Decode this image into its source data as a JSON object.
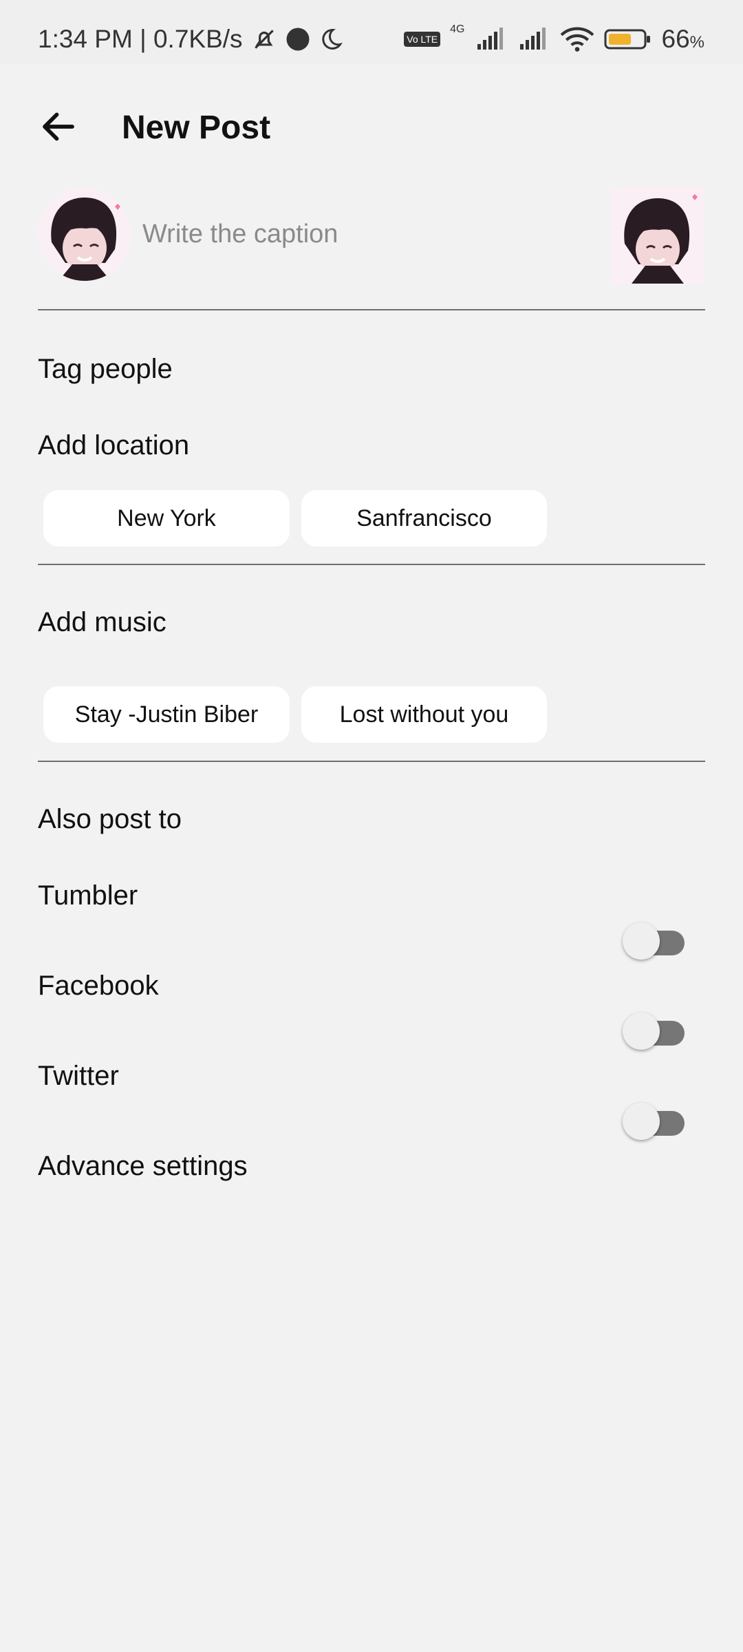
{
  "status_bar": {
    "time_speed": "1:34 PM | 0.7KB/s",
    "network_badge": "Vo LTE",
    "network_type": "4G",
    "battery": "66",
    "battery_unit": "%"
  },
  "header": {
    "title": "New Post"
  },
  "caption": {
    "placeholder": "Write the caption"
  },
  "tag_people": "Tag people",
  "location": {
    "label": "Add location",
    "chips": [
      "New York",
      "Sanfrancisco"
    ]
  },
  "music": {
    "label": "Add music",
    "chips": [
      "Stay -Justin Biber",
      "Lost without you"
    ]
  },
  "share": {
    "label": "Also post to",
    "targets": [
      {
        "label": "Tumbler",
        "enabled": false
      },
      {
        "label": "Facebook",
        "enabled": false
      },
      {
        "label": "Twitter",
        "enabled": false
      }
    ]
  },
  "advance": "Advance settings",
  "colors": {
    "background": "#f2f2f2",
    "toggle_track": "#767676",
    "chip": "#ffffff"
  }
}
